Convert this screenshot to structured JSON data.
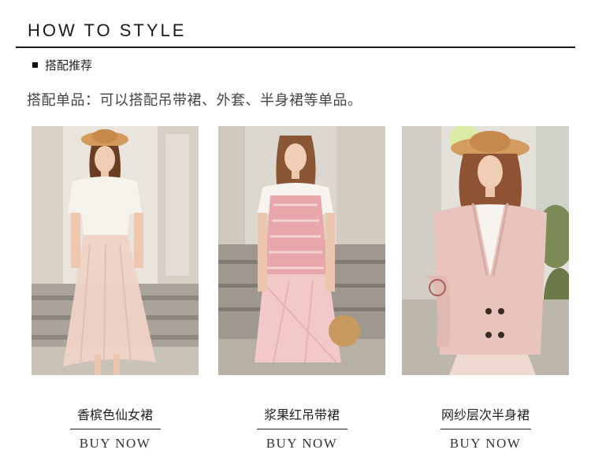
{
  "header": {
    "title": "HOW TO STYLE"
  },
  "section": {
    "label": "搭配推荐",
    "bullet_icon": "square-bullet-icon"
  },
  "intro": "搭配单品：可以搭配吊带裙、外套、半身裙等单品。",
  "products": [
    {
      "name": "香槟色仙女裙",
      "cta": "BUY NOW"
    },
    {
      "name": "浆果红吊带裙",
      "cta": "BUY NOW"
    },
    {
      "name": "网纱层次半身裙",
      "cta": "BUY NOW"
    }
  ],
  "colors": {
    "text": "#222222",
    "rule": "#1a1a1a",
    "accent_pink": "#e8c3bd"
  }
}
